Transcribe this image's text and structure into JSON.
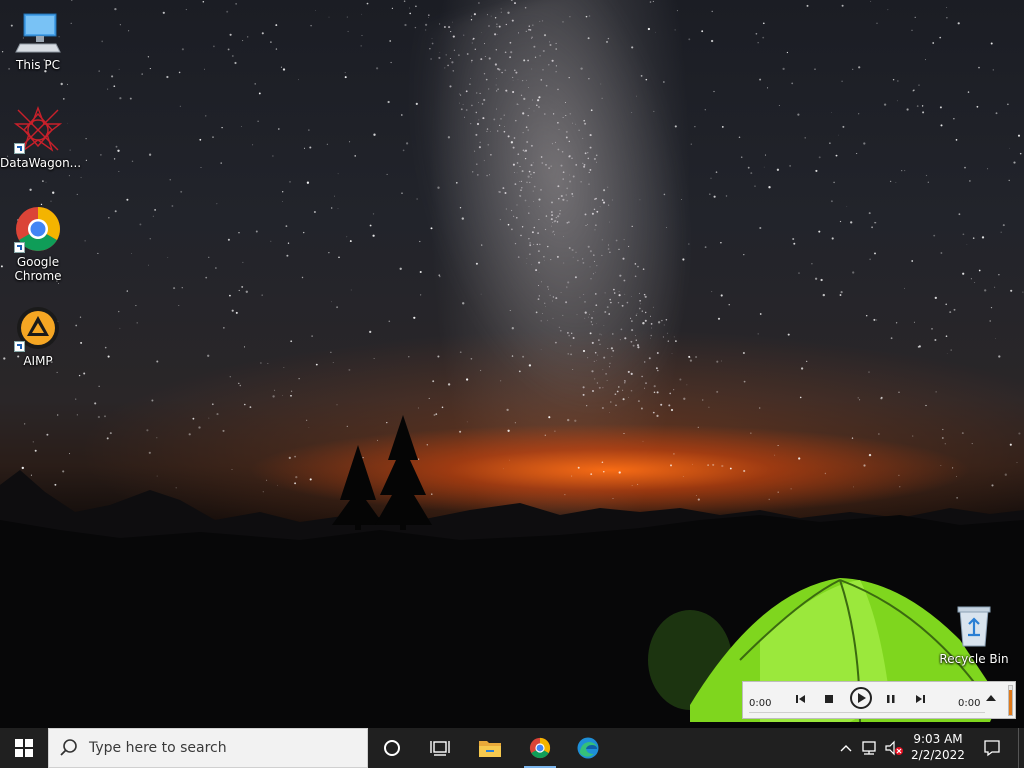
{
  "desktop": {
    "icons": [
      {
        "label": "This PC"
      },
      {
        "label": "DataWagon..."
      },
      {
        "label": "Google Chrome"
      },
      {
        "label": "AIMP"
      },
      {
        "label": "Recycle Bin"
      }
    ]
  },
  "player": {
    "time_elapsed": "0:00",
    "time_total": "0:00",
    "progress": 0,
    "volume": 0.85,
    "controls": [
      "previous-icon",
      "stop-icon",
      "play-icon",
      "pause-icon",
      "next-icon",
      "eject-icon"
    ]
  },
  "taskbar": {
    "search_placeholder": "Type here to search",
    "pinned": [
      "file-explorer-icon",
      "chrome-icon",
      "edge-icon"
    ],
    "clock_time": "9:03 AM",
    "clock_date": "2/2/2022"
  },
  "colors": {
    "taskbar": "#202020",
    "accent": "#7cb5ec",
    "player_volume": "#e07a1b"
  }
}
